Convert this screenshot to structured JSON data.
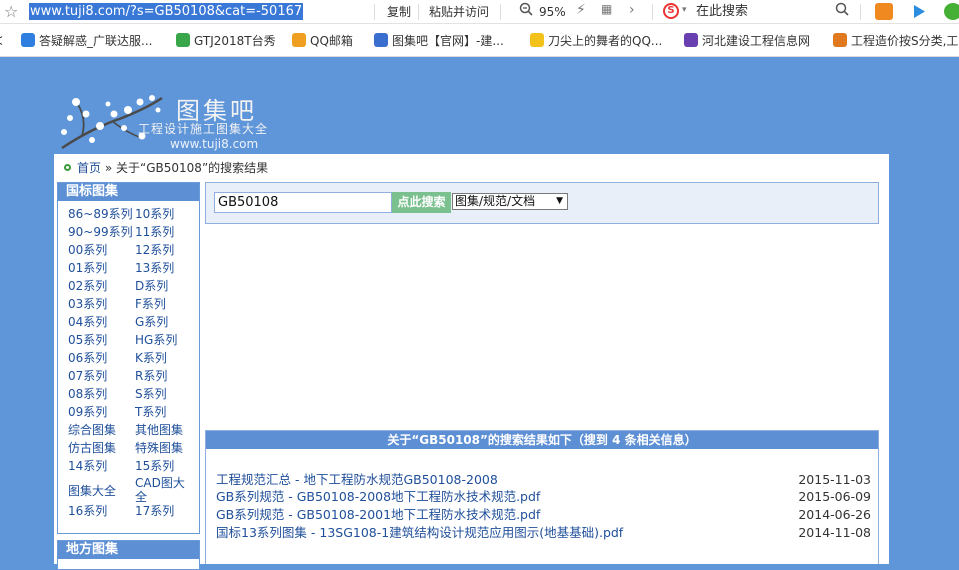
{
  "address_bar": {
    "url": "www.tuji8.com/?s=GB50108&cat=-50167",
    "copy": "复制",
    "paste_go": "粘贴并访问",
    "zoom": "95%",
    "search_placeholder": "在此搜索"
  },
  "bookmarks": [
    {
      "label": "答疑解惑_广联达服...",
      "color": "#2f7fe0"
    },
    {
      "label": "GTJ2018T台秀",
      "color": "#3aa64a"
    },
    {
      "label": "QQ邮箱",
      "color": "#f0a020"
    },
    {
      "label": "图集吧【官网】-建...",
      "color": "#3a6fd0"
    },
    {
      "label": "刀尖上的舞者的QQ...",
      "color": "#f2c21a"
    },
    {
      "label": "河北建设工程信息网",
      "color": "#6a3fb0"
    },
    {
      "label": "工程造价按S分类,工",
      "color": "#e07a20"
    }
  ],
  "logo": {
    "title": "图集吧",
    "subtitle": "工程设计施工图集大全",
    "url": "www.tuji8.com"
  },
  "breadcrumb": {
    "home": "首页",
    "sep": "»",
    "current": "关于“GB50108”的搜索结果"
  },
  "sidebar": {
    "national": {
      "title": "国标图集",
      "items": [
        [
          "86~89系列",
          "10系列"
        ],
        [
          "90~99系列",
          "11系列"
        ],
        [
          "00系列",
          "12系列"
        ],
        [
          "01系列",
          "13系列"
        ],
        [
          "02系列",
          "D系列"
        ],
        [
          "03系列",
          "F系列"
        ],
        [
          "04系列",
          "G系列"
        ],
        [
          "05系列",
          "HG系列"
        ],
        [
          "06系列",
          "K系列"
        ],
        [
          "07系列",
          "R系列"
        ],
        [
          "08系列",
          "S系列"
        ],
        [
          "09系列",
          "T系列"
        ],
        [
          "综合图集",
          "其他图集"
        ],
        [
          "仿古图集",
          "特殊图集"
        ],
        [
          "14系列",
          "15系列"
        ],
        [
          "图集大全",
          "CAD图大全"
        ],
        [
          "16系列",
          "17系列"
        ]
      ]
    },
    "local": {
      "title": "地方图集"
    }
  },
  "search": {
    "value": "GB50108",
    "button": "点此搜索",
    "select": "图集/规范/文档"
  },
  "results": {
    "header": "关于“GB50108”的搜索结果如下（搜到 4 条相关信息）",
    "items": [
      {
        "title": "工程规范汇总 - 地下工程防水规范GB50108-2008",
        "date": "2015-11-03"
      },
      {
        "title": "GB系列规范 - GB50108-2008地下工程防水技术规范.pdf",
        "date": "2015-06-09"
      },
      {
        "title": "GB系列规范 - GB50108-2001地下工程防水技术规范.pdf",
        "date": "2014-06-26"
      },
      {
        "title": "国标13系列图集 - 13SG108-1建筑结构设计规范应用图示(地基基础).pdf",
        "date": "2014-11-08"
      }
    ]
  }
}
